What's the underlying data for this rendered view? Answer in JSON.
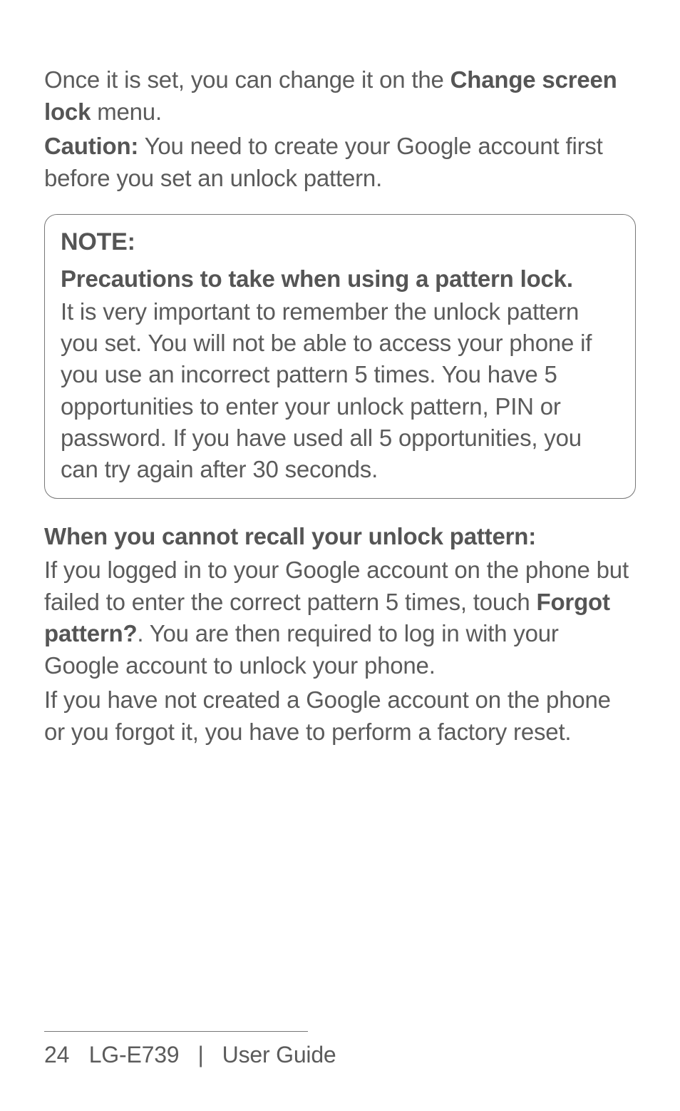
{
  "para1": {
    "t1": "Once it is set, you can change it on the ",
    "b1": "Change screen lock",
    "t2": " menu."
  },
  "para2": {
    "b1": "Caution:",
    "t1": " You need to create your Google account first before you set an unlock pattern."
  },
  "note": {
    "title": "NOTE:",
    "subtitle": "Precautions to take when using a pattern lock.",
    "body": "It is very important to remember the unlock pattern you set. You will not be able to access your phone if you use an incorrect pattern 5 times. You have 5 opportunities to enter your unlock pattern, PIN or password. If you have used all 5 opportunities, you can try again after 30 seconds."
  },
  "section_heading": "When you cannot recall your unlock pattern:",
  "para3": {
    "t1": "If you logged in to your Google account on the phone but failed to enter the correct pattern 5 times, touch ",
    "b1": "Forgot pattern?",
    "t2": ". You are then required to log in with your Google account to unlock your phone."
  },
  "para4": "If you have not created a Google account on the phone or you forgot it, you have to perform a factory reset.",
  "footer": {
    "page_number": "24",
    "model": "LG-E739",
    "separator": "|",
    "guide": "User Guide"
  }
}
